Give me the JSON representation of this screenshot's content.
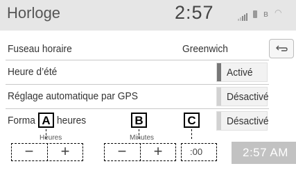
{
  "header": {
    "title": "Horloge",
    "time": "2:57"
  },
  "rows": {
    "timezone": {
      "label": "Fuseau horaire",
      "value": "Greenwich"
    },
    "dst": {
      "label": "Heure d’été",
      "value": "Activé",
      "indicator_color": "#777777"
    },
    "gps": {
      "label": "Réglage automatique par GPS",
      "value": "Désactivé",
      "indicator_color": "#d2d2d2"
    },
    "format24": {
      "label_left": "Forma",
      "label_right": "heures",
      "value": "Désactivé",
      "indicator_color": "#d2d2d2"
    }
  },
  "callouts": {
    "a": "A",
    "b": "B",
    "c": "C"
  },
  "hours": {
    "label": "Heures",
    "minus": "−",
    "plus": "+"
  },
  "minutes": {
    "label": "Minutes",
    "minus": "−",
    "plus": "+"
  },
  "reset": {
    "value": ":00"
  },
  "clock_display": "2:57 AM",
  "icons": [
    "signal-bars-icon",
    "phone-icon",
    "bluetooth-icon",
    "wifi-icon",
    "back-arrow-icon"
  ]
}
